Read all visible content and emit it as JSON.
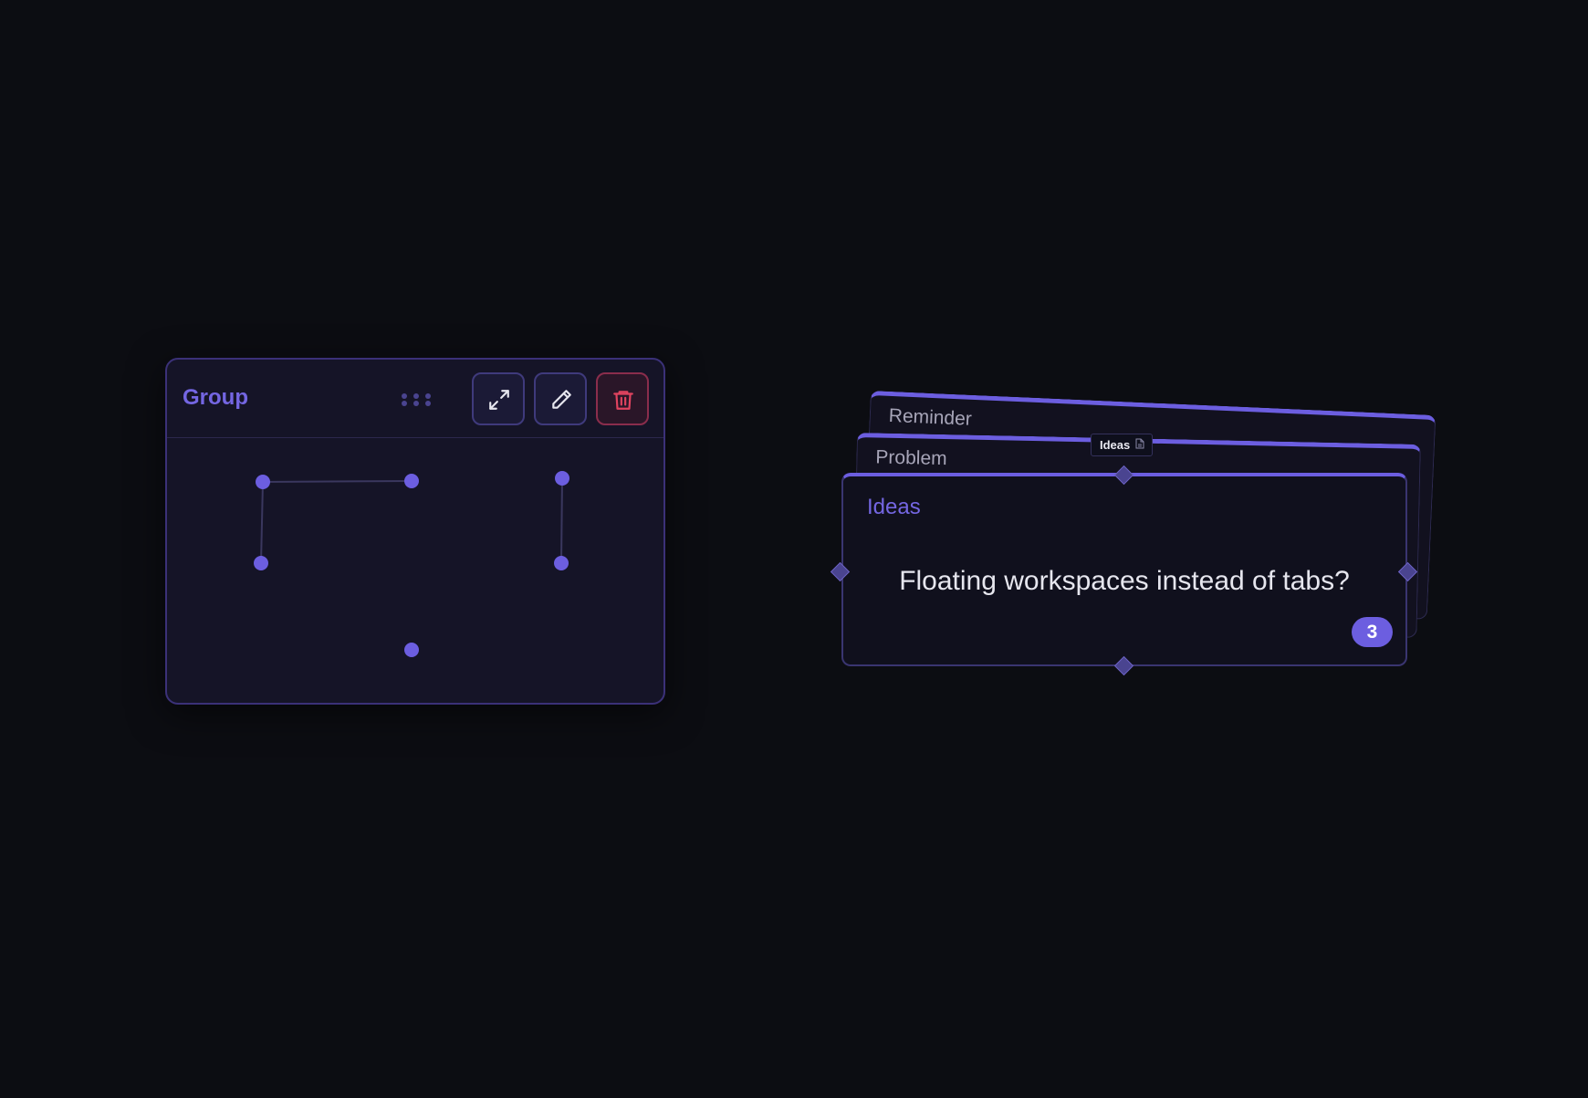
{
  "group": {
    "title": "Group",
    "buttons": {
      "expand": "expand-icon",
      "edit": "pencil-icon",
      "delete": "trash-icon"
    }
  },
  "cards": {
    "stack": [
      {
        "label": "Reminder"
      },
      {
        "label": "Problem"
      }
    ],
    "front": {
      "title": "Ideas",
      "text": "Floating workspaces instead of tabs?",
      "count": "3"
    },
    "chip": {
      "label": "Ideas",
      "icon": "document-icon"
    }
  },
  "colors": {
    "accent": "#6c5ee0",
    "danger": "#e0435f",
    "background": "#0c0d12"
  }
}
